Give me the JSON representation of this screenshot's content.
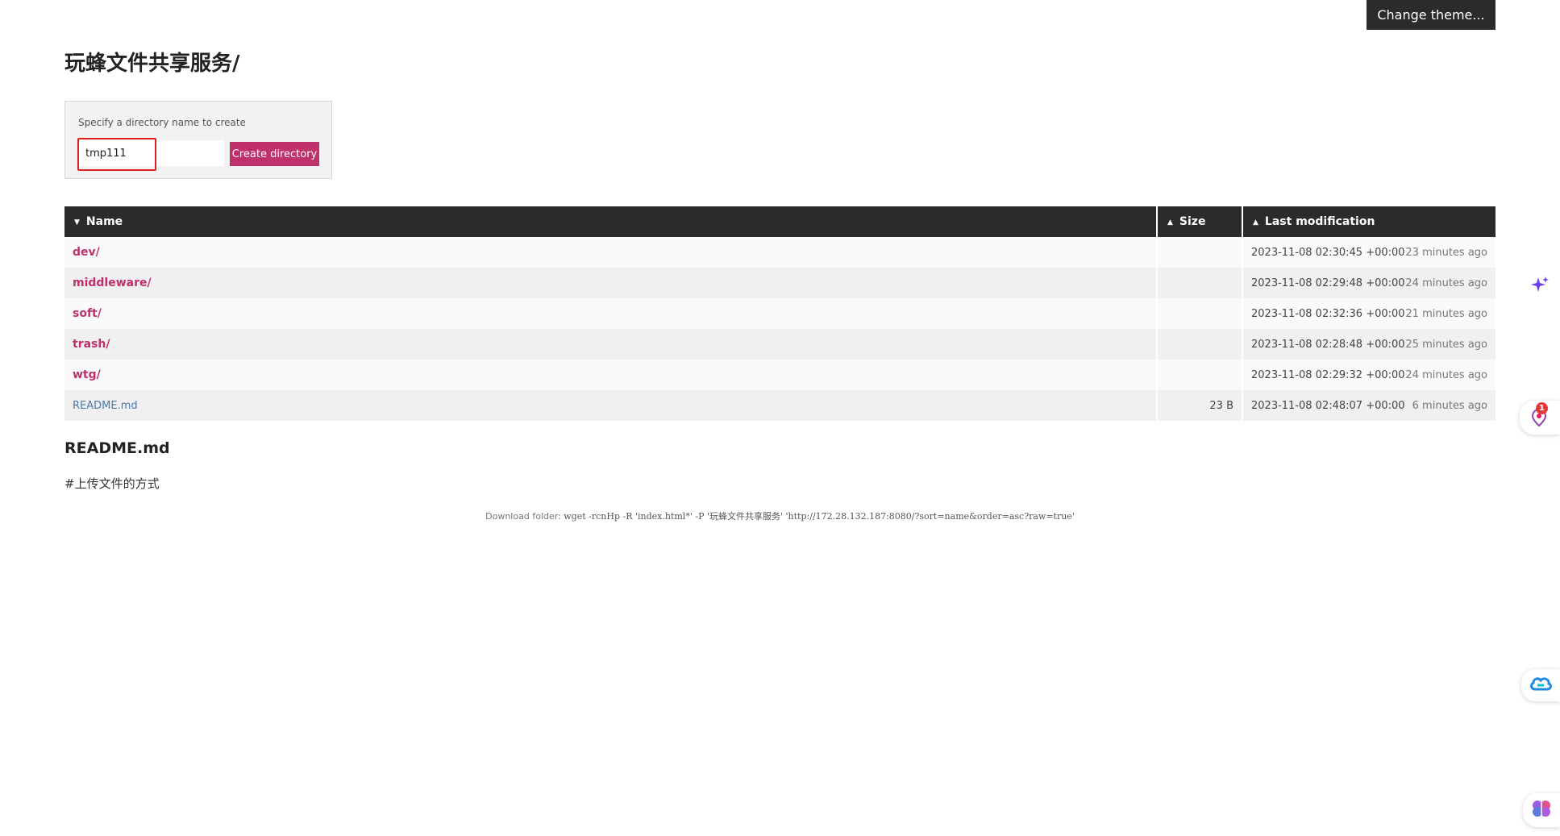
{
  "header": {
    "change_theme_label": "Change theme..."
  },
  "page_title": "玩蜂文件共享服务/",
  "mkdir": {
    "label": "Specify a directory name to create",
    "input_value": "tmp111",
    "button_label": "Create directory"
  },
  "table": {
    "columns": {
      "name": "Name",
      "size": "Size",
      "modified": "Last modification"
    },
    "rows": [
      {
        "name": "dev/",
        "size": "",
        "date": "2023-11-08 02:30:45 +00:00",
        "ago": "23 minutes ago"
      },
      {
        "name": "middleware/",
        "size": "",
        "date": "2023-11-08 02:29:48 +00:00",
        "ago": "24 minutes ago"
      },
      {
        "name": "soft/",
        "size": "",
        "date": "2023-11-08 02:32:36 +00:00",
        "ago": "21 minutes ago"
      },
      {
        "name": "trash/",
        "size": "",
        "date": "2023-11-08 02:28:48 +00:00",
        "ago": "25 minutes ago"
      },
      {
        "name": "wtg/",
        "size": "",
        "date": "2023-11-08 02:29:32 +00:00",
        "ago": "24 minutes ago"
      },
      {
        "name": "README.md",
        "size": "23 B",
        "date": "2023-11-08 02:48:07 +00:00",
        "ago": "6 minutes ago"
      }
    ]
  },
  "readme": {
    "title": "README.md",
    "content": "#上传文件的方式"
  },
  "download": {
    "label": "Download folder:",
    "command": "wget -rcnHp -R 'index.html*' -P '玩蜂文件共享服务' 'http://172.28.132.187:8080/?sort=name&order=asc?raw=true'"
  },
  "side_widgets": {
    "notification_count": "1"
  },
  "icons": {
    "sort_desc": "triangle-down",
    "sort_asc": "triangle-up",
    "sparkle": "sparkle-icon",
    "notification": "pin-icon",
    "cloud": "cloud-link-icon",
    "brain": "brain-icon"
  },
  "colors": {
    "accent": "#c0306a",
    "header_bg": "#2b2b2b",
    "file_link": "#4a78a8",
    "highlight": "#e02020"
  }
}
